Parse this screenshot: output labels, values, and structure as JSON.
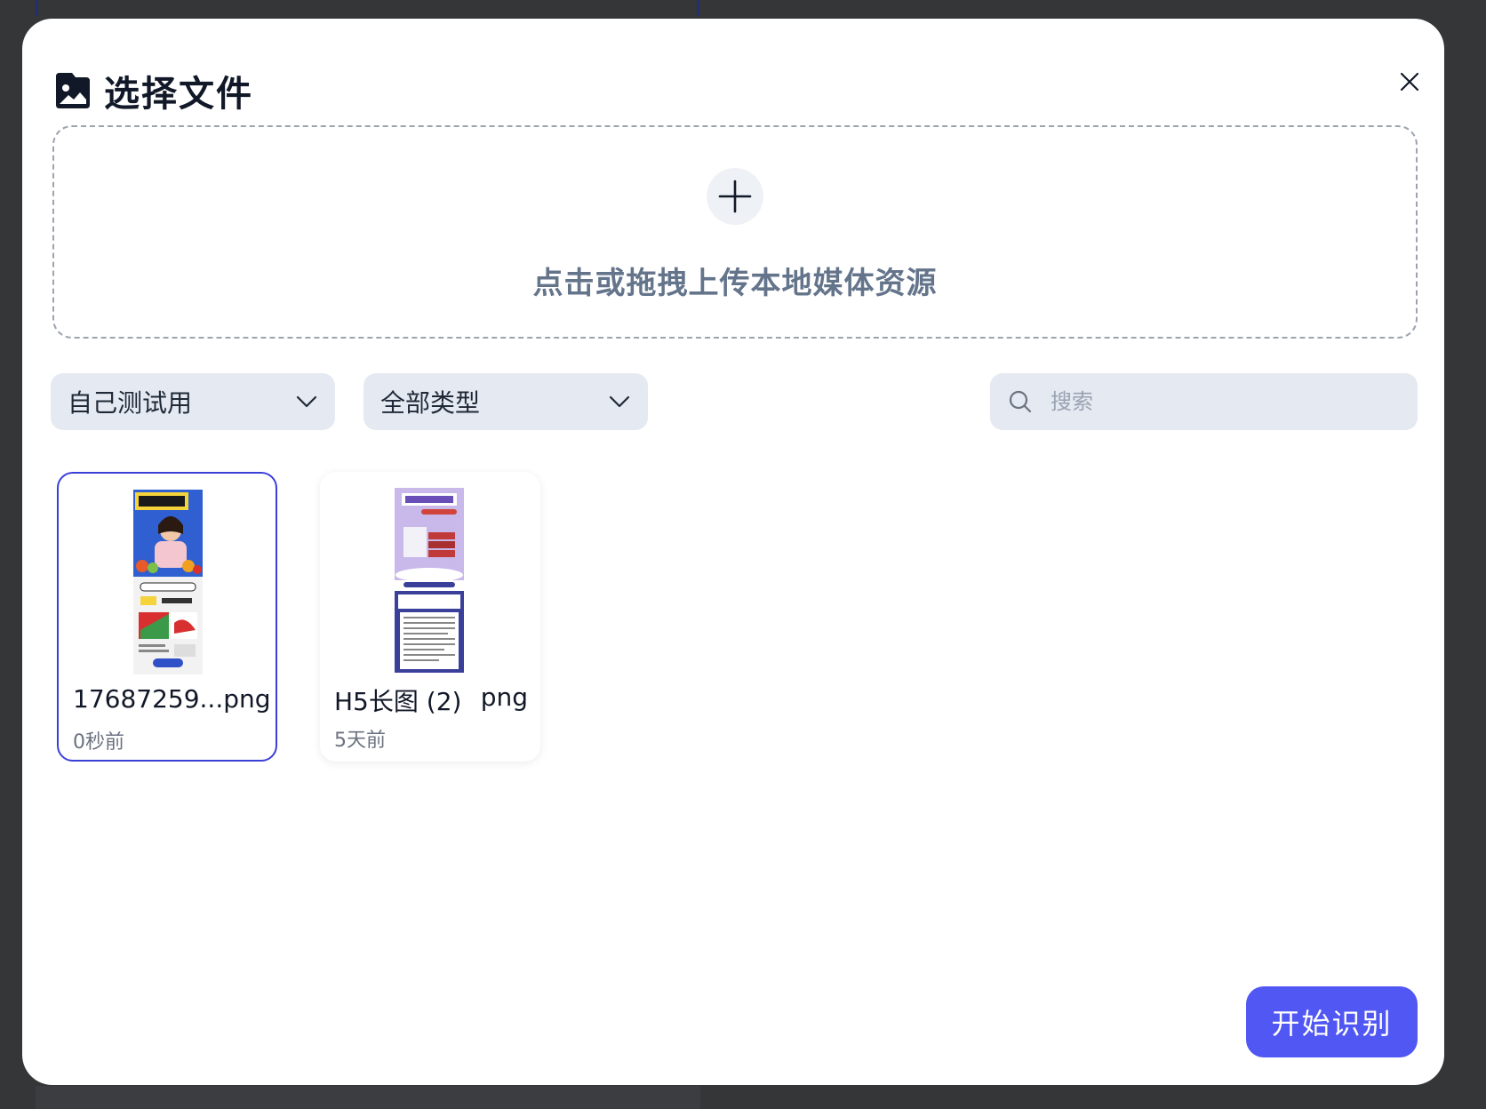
{
  "modal": {
    "title": "选择文件",
    "header_icon": "image-icon",
    "close_icon": "close-icon"
  },
  "upload": {
    "icon": "plus-icon",
    "text": "点击或拖拽上传本地媒体资源"
  },
  "filters": {
    "project_select_value": "自己测试用",
    "type_select_value": "全部类型",
    "search_placeholder": "搜索"
  },
  "files": [
    {
      "name": "17687259...",
      "ext": "png",
      "time": "0秒前",
      "selected": true
    },
    {
      "name": "H5长图 (2)",
      "ext": "png",
      "time": "5天前",
      "selected": false
    }
  ],
  "actions": {
    "start_label": "开始识别"
  },
  "colors": {
    "accent": "#5057f2",
    "selected_border": "#3b3fd8",
    "upload_text": "#64748b",
    "input_bg": "#e5e9f1"
  }
}
